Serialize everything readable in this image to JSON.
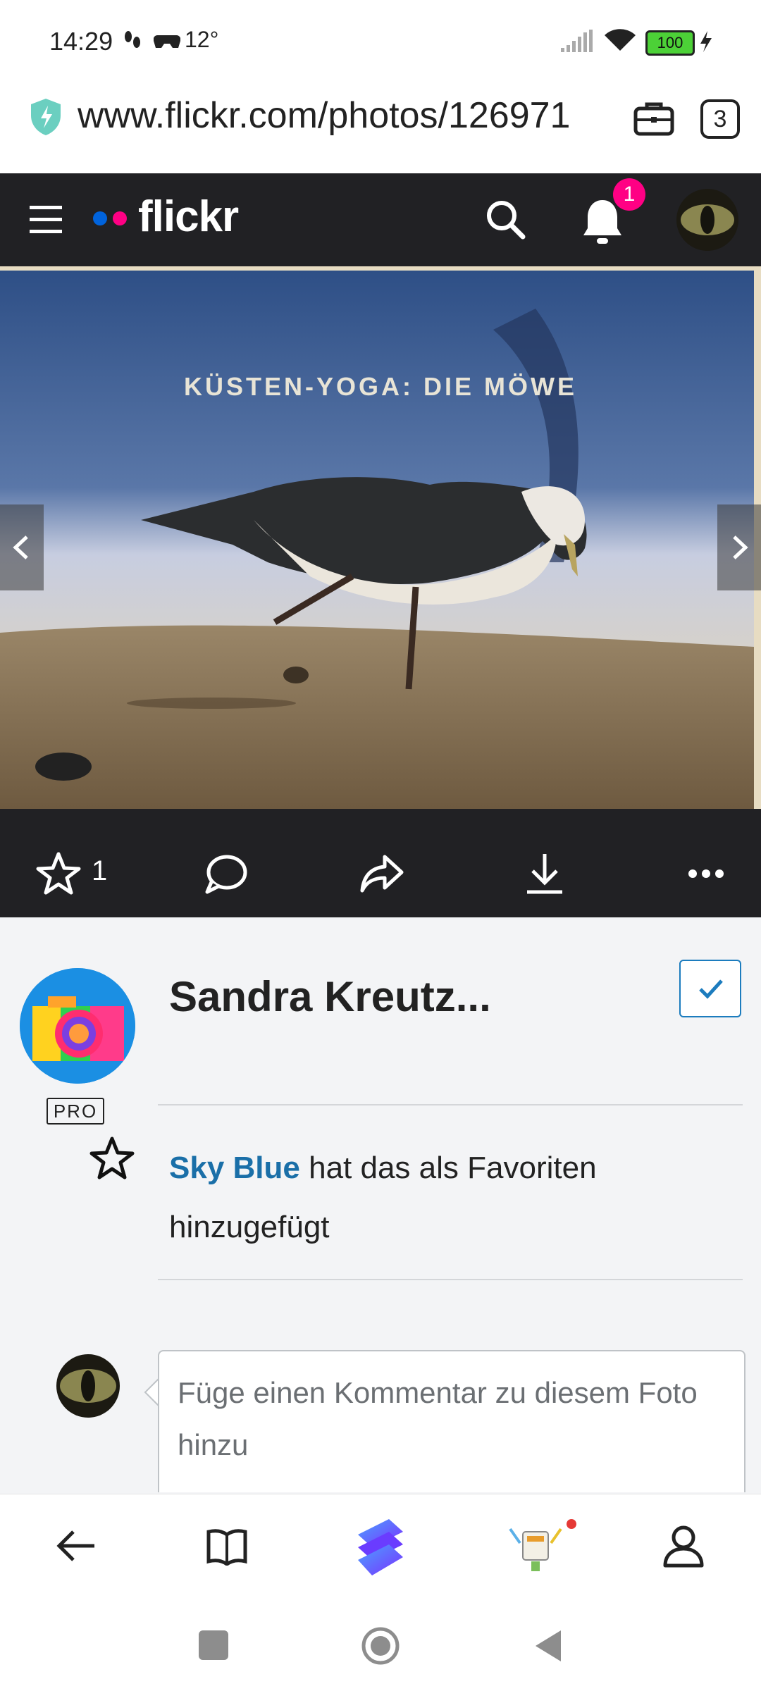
{
  "status_bar": {
    "time": "14:29",
    "temperature": "12°",
    "battery": "100"
  },
  "browser": {
    "url": "www.flickr.com/photos/126971",
    "tab_count": "3"
  },
  "flickr_header": {
    "logo_text": "flickr",
    "notification_count": "1"
  },
  "photo": {
    "title_overlay": "KÜSTEN-YOGA: DIE MÖWE"
  },
  "actions": {
    "favorite_count": "1"
  },
  "author": {
    "name": "Sandra Kreutz...",
    "badge": "PRO"
  },
  "activity": {
    "user": "Sky Blue",
    "text": " hat das als Favoriten hinzugefügt"
  },
  "comment": {
    "placeholder": "Füge einen Kommentar zu diesem Foto hinzu"
  },
  "colors": {
    "flickr_blue": "#0063dc",
    "flickr_pink": "#ff0084",
    "header_bg": "#212124",
    "link_blue": "#1a6fa8"
  },
  "icons": [
    "shield-icon",
    "briefcase-icon",
    "menu-icon",
    "search-icon",
    "bell-icon",
    "star-icon",
    "comment-icon",
    "share-icon",
    "download-icon",
    "more-icon",
    "check-icon",
    "back-icon",
    "book-icon",
    "app-logo-icon",
    "game-icon",
    "profile-icon"
  ]
}
